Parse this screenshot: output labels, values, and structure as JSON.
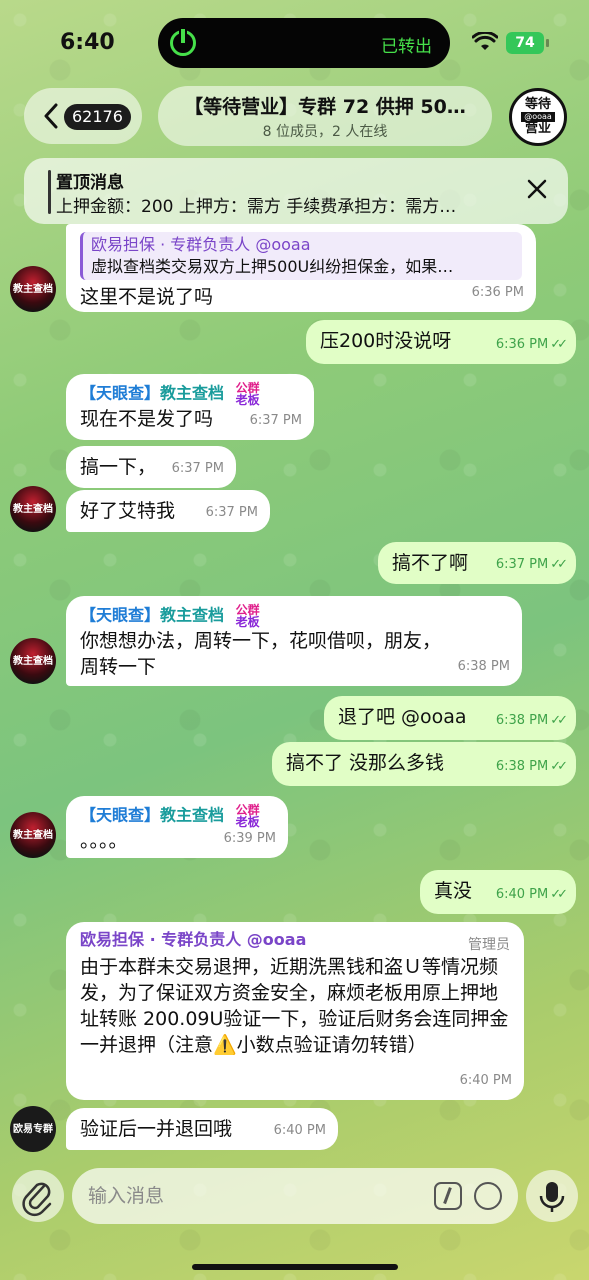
{
  "status": {
    "time": "6:40",
    "island_text": "已转出",
    "battery": "74"
  },
  "header": {
    "unread_count": "62176",
    "title": "【等待营业】专群 72 供押 50…",
    "subtitle": "8 位成员，2 人在线",
    "avatar_line1": "等待",
    "avatar_line2": "@ooaa",
    "avatar_line3": "营业"
  },
  "pinned": {
    "title": "置顶消息",
    "text": "上押金额：200 上押方：需方 手续费承担方：需方…"
  },
  "avatars": {
    "a1": "教主查档",
    "a2": "欧易专群"
  },
  "messages": {
    "m1": {
      "quote_name": "欧易担保 · 专群负责人 @ooaa",
      "quote_text": "虚拟查档类交易双方上押500U纠纷担保金，如果…",
      "text": "这里不是说了吗",
      "time": "6:36 PM"
    },
    "m2": {
      "text": "压200时没说呀",
      "time": "6:36 PM"
    },
    "m3": {
      "sender1": "【天眼查】",
      "sender2": "教主查档",
      "badge1": "公群",
      "badge2": "老板",
      "text": "现在不是发了吗",
      "time": "6:37 PM"
    },
    "m4": {
      "text": "搞一下，",
      "time": "6:37 PM"
    },
    "m5": {
      "text": "好了艾特我",
      "time": "6:37 PM"
    },
    "m6": {
      "text": "搞不了啊",
      "time": "6:37 PM"
    },
    "m7": {
      "sender1": "【天眼查】",
      "sender2": "教主查档",
      "badge1": "公群",
      "badge2": "老板",
      "text": "你想想办法，周转一下，花呗借呗，朋友，周转一下",
      "time": "6:38 PM"
    },
    "m8": {
      "text": "退了吧 @ooaa",
      "time": "6:38 PM"
    },
    "m9": {
      "text": "搞不了  没那么多钱",
      "time": "6:38 PM"
    },
    "m10": {
      "sender1": "【天眼查】",
      "sender2": "教主查档",
      "badge1": "公群",
      "badge2": "老板",
      "text": "。。。。",
      "time": "6:39 PM"
    },
    "m11": {
      "text": "真没",
      "time": "6:40 PM"
    },
    "m12": {
      "sender": "欧易担保 · 专群负责人 @ooaa",
      "role": "管理员",
      "text": "由于本群未交易退押，近期洗黑钱和盗Ｕ等情况频发，为了保证双方资金安全，麻烦老板用原上押地址转账 200.09U验证一下，验证后财务会连同押金一并退押（注意⚠️小数点验证请勿转错）",
      "time": "6:40 PM"
    },
    "m13": {
      "text": "验证后一并退回哦",
      "time": "6:40 PM"
    }
  },
  "composer": {
    "placeholder": "输入消息"
  }
}
